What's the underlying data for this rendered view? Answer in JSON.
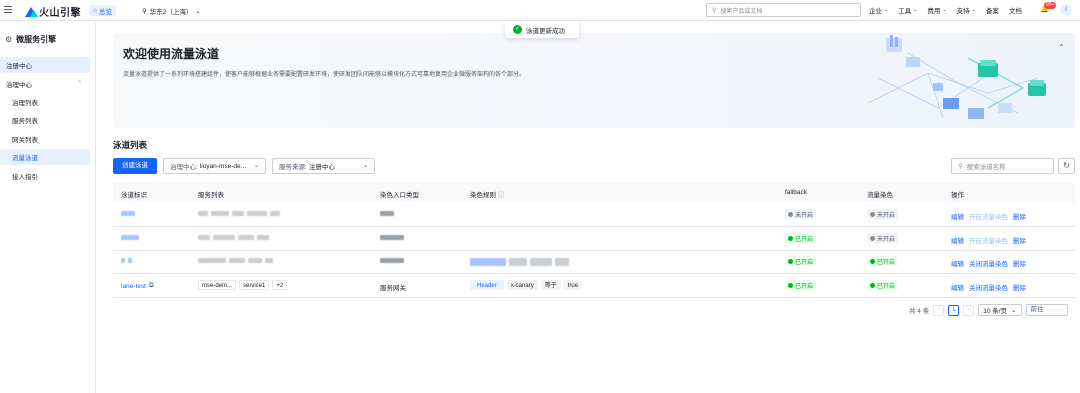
{
  "topbar": {
    "brand": "火山引擎",
    "home_label": "总览",
    "region": "华东2（上海）",
    "search_placeholder": "搜索产品或文档",
    "nav": [
      "企业",
      "工具",
      "费用",
      "支持",
      "备案",
      "文档"
    ],
    "notification_count": "99+",
    "user_initial": "I"
  },
  "toast": {
    "message": "泳道更新成功"
  },
  "sidebar": {
    "title": "微服务引擎",
    "items": [
      {
        "label": "注册中心"
      },
      {
        "label": "治理中心"
      },
      {
        "label": "治理列表"
      },
      {
        "label": "服务列表"
      },
      {
        "label": "网关列表"
      },
      {
        "label": "流量泳道"
      },
      {
        "label": "接入指引"
      }
    ]
  },
  "banner": {
    "title": "欢迎使用流量泳道",
    "description": "流量泳道提供了一系列环境搭建组件，使客户能够根据业务需要配置研发环境，使研发团队间能够以模块化方式可靠地复用企业微服务架构的各个部分。"
  },
  "list": {
    "title": "泳道列表",
    "create_button": "创建泳道",
    "filter_governance_label": "治理中心:",
    "filter_governance_value": "liuyan-mse-de...",
    "filter_source_label": "服务来源:",
    "filter_source_value": "注册中心",
    "search_placeholder": "搜索泳道名称",
    "columns": [
      "泳道标识",
      "服务列表",
      "染色入口类型",
      "染色规则",
      "fallback",
      "流量染色",
      "操作"
    ],
    "rows": [
      {
        "fallback": "未开启",
        "fallback_on": false,
        "dye": "未开启",
        "dye_on": false,
        "actions": [
          "编辑",
          "开启流量染色",
          "删除"
        ]
      },
      {
        "fallback": "已开启",
        "fallback_on": true,
        "dye": "未开启",
        "dye_on": false,
        "actions": [
          "编辑",
          "开启流量染色",
          "删除"
        ]
      },
      {
        "fallback": "已开启",
        "fallback_on": true,
        "dye": "已开启",
        "dye_on": true,
        "actions": [
          "编辑",
          "关闭流量染色",
          "删除"
        ]
      },
      {
        "name": "lane-test",
        "services": [
          "mse-dem...",
          "service1",
          "+2"
        ],
        "entry_type": "服务网关",
        "rule": [
          "Header",
          "x-canary",
          "等于",
          "true"
        ],
        "fallback": "已开启",
        "fallback_on": true,
        "dye": "已开启",
        "dye_on": true,
        "actions": [
          "编辑",
          "关闭流量染色",
          "删除"
        ]
      }
    ]
  },
  "pagination": {
    "total": "共 4 条",
    "current": "1",
    "page_size": "10 条/页",
    "goto": "前往"
  },
  "colors": {
    "primary": "#1664ff",
    "success": "#00b42a",
    "accent": "#00d6c2"
  }
}
